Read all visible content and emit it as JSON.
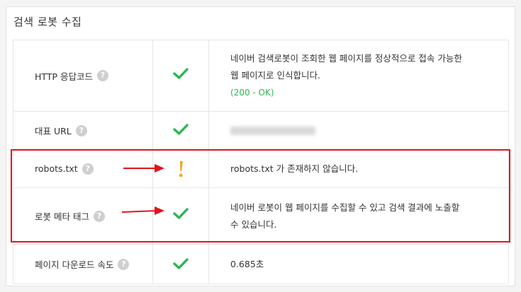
{
  "title": "검색 로봇 수집",
  "help_glyph": "?",
  "rows": [
    {
      "label": "HTTP 응답코드",
      "status_icon": "check-icon",
      "desc_line1": "네이버 검색로봇이 조회한 웹 페이지를 정상적으로 접속 가능한",
      "desc_line2": "웹 페이지로 인식합니다.",
      "desc_code": "(200 - OK)"
    },
    {
      "label": "대표 URL",
      "status_icon": "check-icon"
    },
    {
      "label": "robots.txt",
      "status_icon": "warning-icon",
      "desc_line1": "robots.txt 가 존재하지 않습니다."
    },
    {
      "label": "로봇 메타 태그",
      "status_icon": "check-icon",
      "desc_line1": "네이버 로봇이 웹 페이지를 수집할 수 있고 검색 결과에 노출할",
      "desc_line2": "수 있습니다."
    },
    {
      "label": "페이지 다운로드 속도",
      "status_icon": "check-icon",
      "desc_line1": "0.685초"
    }
  ],
  "colors": {
    "check": "#2fb451",
    "warning": "#f5a623",
    "highlight": "#e1141b",
    "ok_code": "#2fb451"
  }
}
